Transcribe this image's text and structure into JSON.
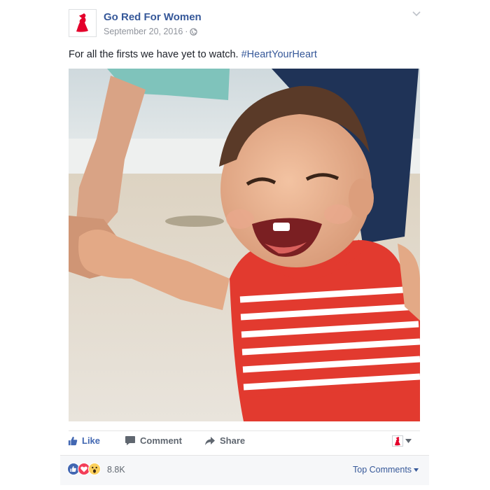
{
  "post": {
    "page_name": "Go Red For Women",
    "date": "September 20, 2016",
    "date_separator": "·",
    "text": "For all the firsts we have yet to watch. ",
    "hashtag": "#HeartYourHeart",
    "photo_icon": "photo-of-laughing-baby-in-red-striped-tank-on-beach"
  },
  "actions": {
    "like_label": "Like",
    "comment_label": "Comment",
    "share_label": "Share"
  },
  "reactions": {
    "count": "8.8K",
    "icons": [
      "like-icon",
      "love-icon",
      "wow-icon"
    ],
    "top_comments_label": "Top Comments"
  },
  "colors": {
    "link_blue": "#365899",
    "like_blue": "#4267b2",
    "brand_red": "#e4002b",
    "meta_gray": "#90949c"
  }
}
